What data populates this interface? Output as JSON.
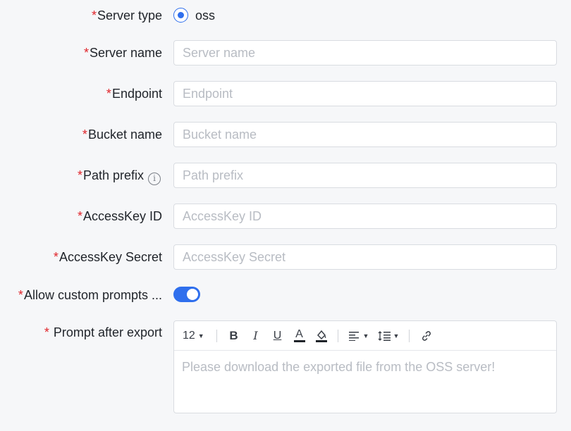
{
  "form": {
    "required_mark": "*",
    "server_type": {
      "label": "Server type",
      "option": "oss",
      "selected": true
    },
    "server_name": {
      "label": "Server name",
      "placeholder": "Server name",
      "value": ""
    },
    "endpoint": {
      "label": "Endpoint",
      "placeholder": "Endpoint",
      "value": ""
    },
    "bucket_name": {
      "label": "Bucket name",
      "placeholder": "Bucket name",
      "value": ""
    },
    "path_prefix": {
      "label": "Path prefix",
      "placeholder": "Path prefix",
      "value": "",
      "info_icon": "info-icon"
    },
    "access_key_id": {
      "label": "AccessKey ID",
      "placeholder": "AccessKey ID",
      "value": ""
    },
    "access_key_secret": {
      "label": "AccessKey Secret",
      "placeholder": "AccessKey Secret",
      "value": ""
    },
    "allow_custom_prompts": {
      "label": "Allow custom prompts ...",
      "enabled": true
    },
    "prompt_after_export": {
      "label": "Prompt after export",
      "required_mark": "* ",
      "toolbar": {
        "font_size": "12",
        "bold": "B",
        "italic": "I",
        "underline": "U",
        "font_color": "A",
        "icons": [
          "chevron-down-icon",
          "bold-icon",
          "italic-icon",
          "underline-icon",
          "font-color-icon",
          "fill-color-icon",
          "align-left-icon",
          "line-height-icon",
          "link-icon"
        ]
      },
      "placeholder": "Please download the exported file from the OSS server!"
    }
  },
  "colors": {
    "accent": "#2f6fed",
    "required": "#e0252b",
    "placeholder": "#b8bcc3",
    "border": "#d9dce1",
    "background": "#f6f7f9"
  }
}
